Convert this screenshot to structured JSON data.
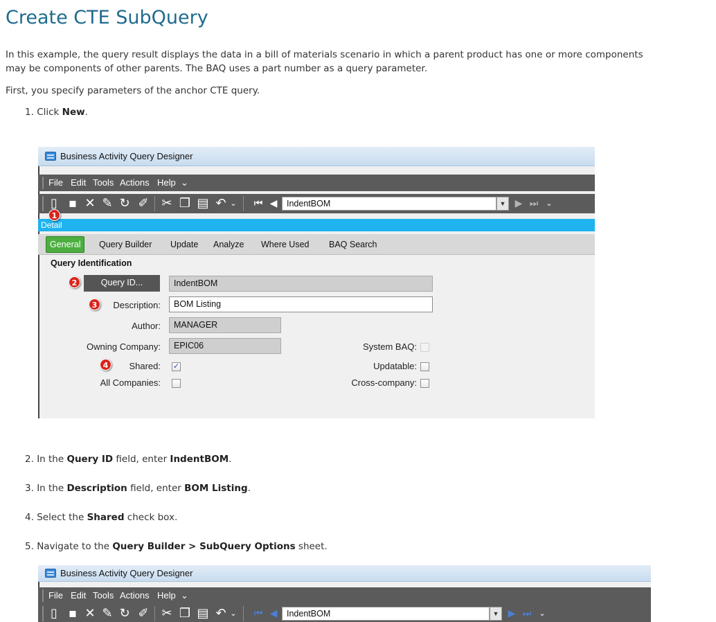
{
  "doc": {
    "title": "Create CTE SubQuery",
    "intro_line1": "In this example, the query result displays the data in a bill of materials scenario in which a parent product has one or more components",
    "intro_line2": "may be components of other parents. The BAQ uses a part number as a query parameter.",
    "first_line": "First, you specify parameters of the anchor CTE query."
  },
  "steps": [
    {
      "num": "1.",
      "pre": "Click ",
      "bold": "New",
      "post": "."
    },
    {
      "num": "2.",
      "pre": "In the ",
      "bold": "Query ID",
      "mid": " field, enter ",
      "bold2": "IndentBOM",
      "post": "."
    },
    {
      "num": "3.",
      "pre": "In the ",
      "bold": "Description",
      "mid": " field, enter ",
      "bold2": "BOM Listing",
      "post": "."
    },
    {
      "num": "4.",
      "pre": "Select the ",
      "bold": "Shared",
      "post": " check box."
    },
    {
      "num": "5.",
      "pre": "Navigate to the ",
      "bold": "Query Builder > SubQuery Options",
      "post": " sheet."
    }
  ],
  "app": {
    "window_title": "Business Activity Query Designer",
    "menu": [
      "File",
      "Edit",
      "Tools",
      "Actions",
      "Help"
    ],
    "menu_more": "⌄",
    "record": "IndentBOM",
    "detail_label": "Detail",
    "tabs": [
      "General",
      "Query Builder",
      "Update",
      "Analyze",
      "Where Used",
      "BAQ Search"
    ],
    "section": "Query Identification",
    "query_id_button": "Query ID...",
    "query_id_value": "IndentBOM",
    "description_label": "Description:",
    "description_value": "BOM Listing",
    "author_label": "Author:",
    "author_value": "MANAGER",
    "owning_company_label": "Owning Company:",
    "owning_company_value": "EPIC06",
    "shared_label": "Shared:",
    "shared_checked": "✓",
    "all_companies_label": "All Companies:",
    "system_baq_label": "System BAQ:",
    "updatable_label": "Updatable:",
    "cross_company_label": "Cross-company:",
    "callouts": [
      "1",
      "2",
      "3",
      "4"
    ]
  },
  "icons": {
    "new": "new-file-icon",
    "save": "save-icon",
    "delete": "delete-icon",
    "attach": "attach-icon",
    "refresh": "refresh-icon",
    "clear": "clear-icon",
    "cut": "cut-icon",
    "copy": "copy-icon",
    "paste": "paste-icon",
    "undo": "undo-icon",
    "first": "first-record-icon",
    "prev": "previous-record-icon",
    "next": "next-record-icon",
    "last": "last-record-icon"
  },
  "colors": {
    "title": "#1f6b8e",
    "menubar": "#5b5b5b",
    "detail_bar": "#1fb3f0",
    "active_tab": "#4cae3f",
    "callout": "#d9251c"
  }
}
